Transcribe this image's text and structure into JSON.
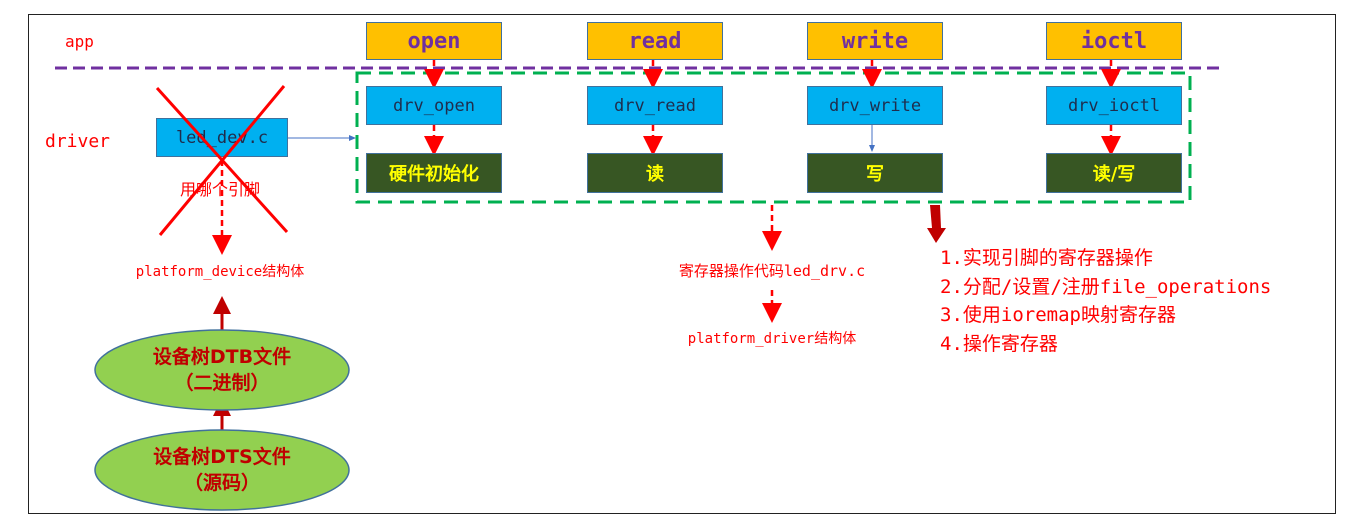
{
  "layers": {
    "app": "app",
    "driver": "driver"
  },
  "app_calls": [
    "open",
    "read",
    "write",
    "ioctl"
  ],
  "driver_funcs": [
    "drv_open",
    "drv_read",
    "drv_write",
    "drv_ioctl"
  ],
  "hw_ops": [
    "硬件初始化",
    "读",
    "写",
    "读/写"
  ],
  "left": {
    "file": "led_dev.c",
    "crossed_note": "用哪个引脚",
    "struct": "platform_device结构体",
    "dtb": [
      "设备树DTB文件",
      "（二进制）"
    ],
    "dts": [
      "设备树DTS文件",
      "（源码）"
    ]
  },
  "middle": {
    "code": "寄存器操作代码led_drv.c",
    "struct": "platform_driver结构体"
  },
  "steps": [
    "1.实现引脚的寄存器操作",
    "2.分配/设置/注册file_operations",
    "3.使用ioremap映射寄存器",
    "4.操作寄存器"
  ],
  "colors": {
    "app": "#ffc000",
    "driver": "#00b0f0",
    "hw": "#375623",
    "layer_line": "#7030a0",
    "driver_group": "#00b050",
    "text": "#ff0000"
  }
}
